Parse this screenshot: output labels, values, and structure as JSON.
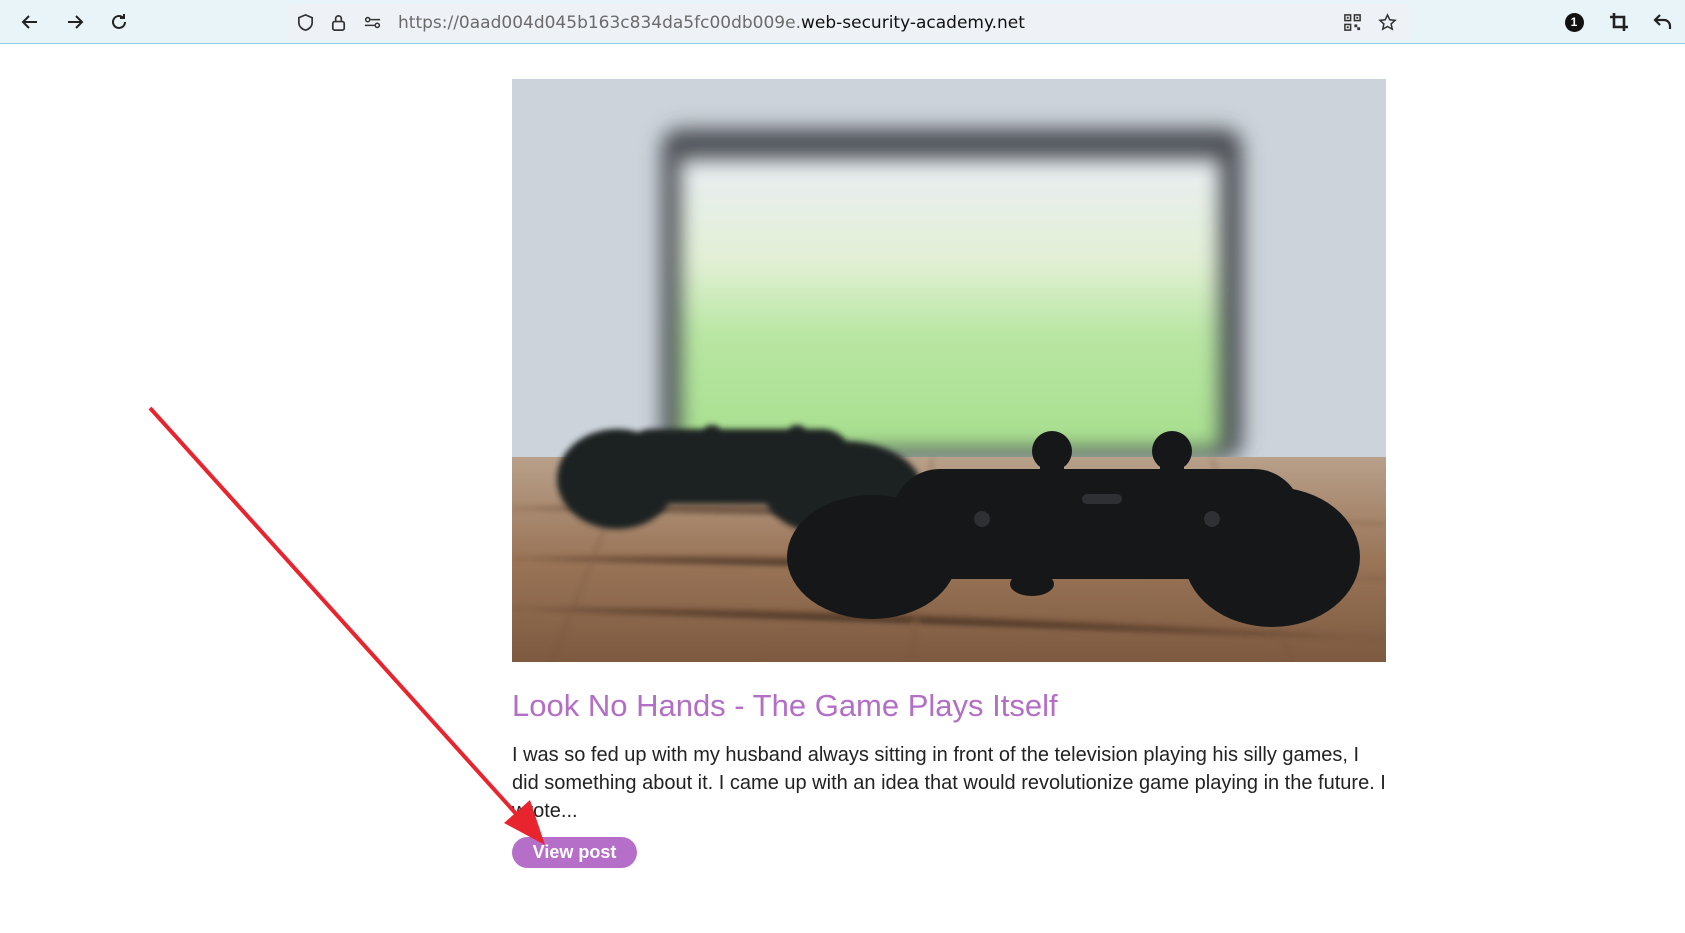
{
  "browser": {
    "url_prefix": "https://0aad004d045b163c834da5fc00db009e.",
    "url_host": "web-security-academy.net",
    "extension_badge": "1"
  },
  "post": {
    "title": "Look No Hands - The Game Plays Itself",
    "summary": "I was so fed up with my husband always sitting in front of the television playing his silly games, I did something about it. I came up with an idea that would revolutionize game playing in the future. I wrote...",
    "button_label": "View post"
  },
  "colors": {
    "accent": "#b36ec6",
    "annotation_arrow": "#e8252e"
  }
}
